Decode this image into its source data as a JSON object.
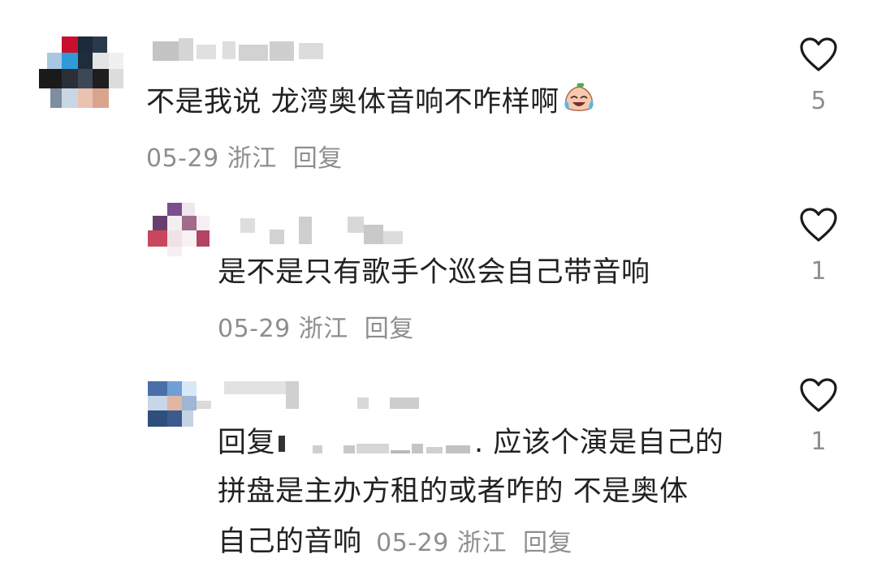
{
  "comments": [
    {
      "text": "不是我说 龙湾奥体音响不咋样啊",
      "emoji": "crying-laughing-peach-emoji",
      "date": "05-29",
      "location": "浙江",
      "reply_label": "回复",
      "likes": "5"
    },
    {
      "text": "是不是只有歌手个巡会自己带音响",
      "date": "05-29",
      "location": "浙江",
      "reply_label": "回复",
      "likes": "1"
    },
    {
      "reply_prefix": "回复",
      "line1_tail": ". 应该个演是自己的",
      "line2": "拼盘是主办方租的或者咋的 不是奥体",
      "line3": "自己的音响",
      "date": "05-29",
      "location": "浙江",
      "reply_label": "回复",
      "likes": "1"
    }
  ],
  "colors": {
    "text": "#222222",
    "meta": "#8e8e8e",
    "heart_stroke": "#1a1a1a"
  }
}
